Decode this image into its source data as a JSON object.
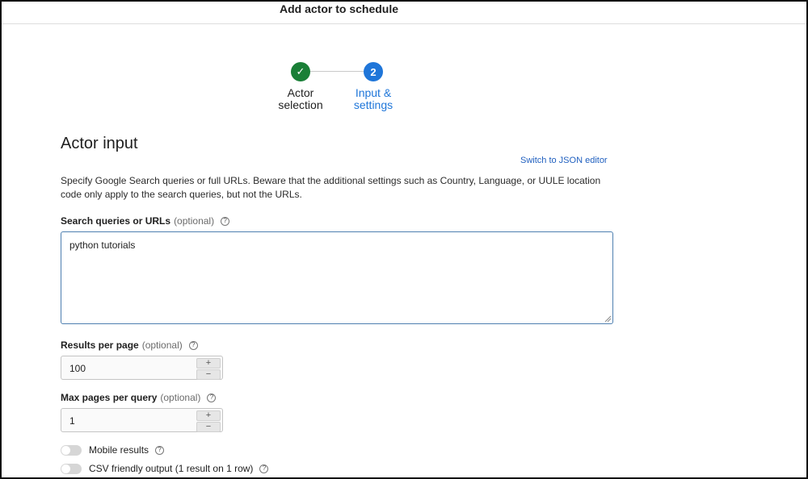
{
  "dialog": {
    "title": "Add actor to schedule"
  },
  "stepper": {
    "steps": [
      {
        "label_line1": "Actor",
        "label_line2": "selection",
        "state": "completed",
        "marker": "✓"
      },
      {
        "label_line1": "Input &",
        "label_line2": "settings",
        "state": "active",
        "marker": "2"
      }
    ]
  },
  "section": {
    "title": "Actor input",
    "json_editor_link": "Switch to JSON editor",
    "description": "Specify Google Search queries or full URLs. Beware that the additional settings such as Country, Language, or UULE location code only apply to the search queries, but not the URLs."
  },
  "fields": {
    "queries": {
      "label": "Search queries or URLs",
      "optional": "(optional)",
      "value": "python tutorials"
    },
    "results_per_page": {
      "label": "Results per page",
      "optional": "(optional)",
      "value": "100"
    },
    "max_pages": {
      "label": "Max pages per query",
      "optional": "(optional)",
      "value": "1"
    },
    "mobile_results": {
      "label": "Mobile results",
      "enabled": false
    },
    "csv_output": {
      "label": "CSV friendly output (1 result on 1 row)",
      "enabled": false
    }
  },
  "icons": {
    "help": "?",
    "plus": "+",
    "minus": "−"
  },
  "colors": {
    "success": "#1a7f37",
    "primary": "#1f76d9",
    "link": "#1f5fbf"
  }
}
